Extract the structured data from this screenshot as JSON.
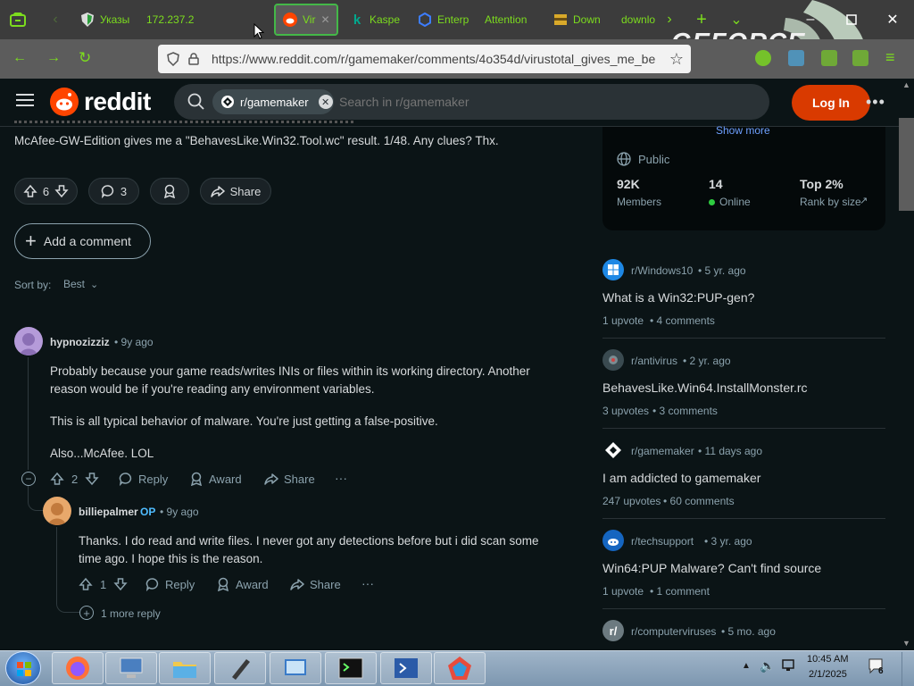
{
  "browser": {
    "tabs": [
      {
        "label": "Указы"
      },
      {
        "label": "172.237.2"
      },
      {
        "label": "Vir"
      },
      {
        "label": "Kaspe"
      },
      {
        "label": "Enterp"
      },
      {
        "label": "Attention"
      },
      {
        "label": "Down"
      },
      {
        "label": "downlo"
      }
    ],
    "url": "https://www.reddit.com/r/gamemaker/comments/4o354d/virustotal_gives_me_be",
    "overlay_text": "GEFORCE"
  },
  "header": {
    "logo_text": "reddit",
    "subreddit_chip": "r/gamemaker",
    "search_placeholder": "Search in r/gamemaker",
    "login_label": "Log In"
  },
  "post": {
    "text_tail": "McAfee-GW-Edition gives me a \"BehavesLike.Win32.Tool.wc\" result. 1/48. Any clues? Thx.",
    "votes": "6",
    "comments": "3",
    "share_label": "Share",
    "add_comment_label": "Add a comment",
    "sort_label": "Sort by:",
    "sort_value": "Best"
  },
  "comments": [
    {
      "author": "hypnozizziz",
      "time": "• 9y ago",
      "paragraphs": [
        "Probably because your game reads/writes INIs or files within its working directory. Another",
        "reason would be if you're reading any environment variables.",
        "This is all typical behavior of malware. You're just getting a false-positive.",
        "Also...McAfee. LOL"
      ],
      "votes": "2",
      "reply_label": "Reply",
      "award_label": "Award",
      "share_label": "Share"
    },
    {
      "author": "billiepalmer",
      "op_badge": "OP",
      "time": "• 9y ago",
      "paragraphs": [
        "Thanks. I do read and write files. I never got any detections before but i did scan some",
        "time ago. I hope this is the reason."
      ],
      "votes": "1",
      "reply_label": "Reply",
      "award_label": "Award",
      "share_label": "Share",
      "more_replies": "1 more reply"
    }
  ],
  "sidebar": {
    "show_more": "Show more",
    "visibility": "Public",
    "stats": [
      {
        "value": "92K",
        "label": "Members"
      },
      {
        "value": "14",
        "label": "Online"
      },
      {
        "value": "Top 2%",
        "label": "Rank by size"
      }
    ],
    "related": [
      {
        "sub": "r/Windows10",
        "time": "• 5 yr. ago",
        "title": "What is a Win32:PUP-gen?",
        "upvotes": "1 upvote",
        "comments": "4 comments",
        "icon_color": "#1e88e5"
      },
      {
        "sub": "r/antivirus",
        "time": "• 2 yr. ago",
        "title": "BehavesLike.Win64.InstallMonster.rc",
        "upvotes": "3 upvotes",
        "comments": "3 comments",
        "icon_color": "#3a4a50"
      },
      {
        "sub": "r/gamemaker",
        "time": "• 11 days ago",
        "title": "I am addicted to gamemaker",
        "upvotes": "247 upvotes",
        "comments": "60 comments",
        "icon_color": "#0b1416"
      },
      {
        "sub": "r/techsupport",
        "time": "• 3 yr. ago",
        "title": "Win64:PUP Malware? Can't find source",
        "upvotes": "1 upvote",
        "comments": "1 comment",
        "icon_color": "#1565c0"
      },
      {
        "sub": "r/computerviruses",
        "time": "• 5 mo. ago",
        "icon_color": "#6c7a80"
      }
    ]
  },
  "taskbar": {
    "time": "10:45 AM",
    "date": "2/1/2025",
    "notification_count": "6"
  },
  "colors": {
    "accent": "#d93a00",
    "browser_green": "#7cdc1e",
    "online": "#2ecc40"
  }
}
